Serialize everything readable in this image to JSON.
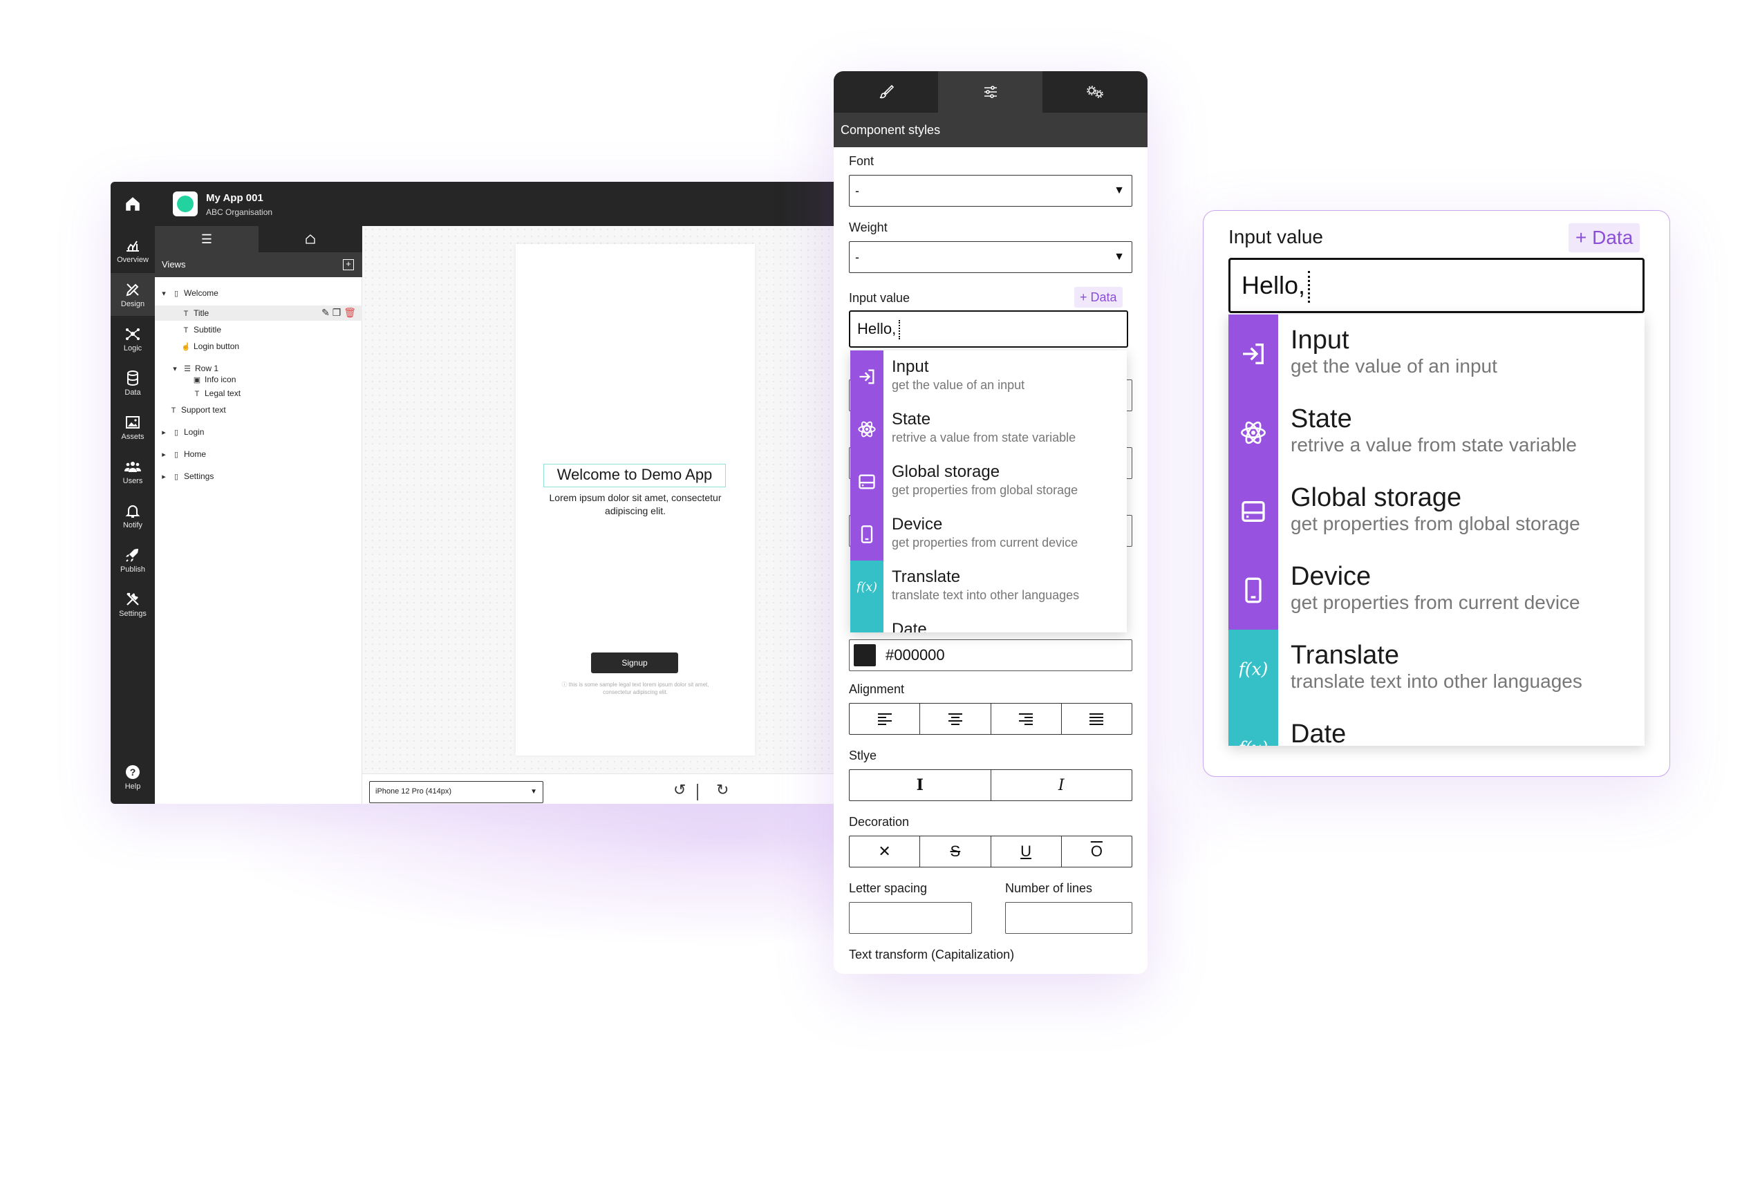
{
  "editor": {
    "app_name": "My App 001",
    "org_name": "ABC Organisation",
    "rail": [
      {
        "label": "Overview",
        "icon": "chart-icon"
      },
      {
        "label": "Design",
        "icon": "design-icon"
      },
      {
        "label": "Logic",
        "icon": "logic-icon"
      },
      {
        "label": "Data",
        "icon": "database-icon"
      },
      {
        "label": "Assets",
        "icon": "image-icon"
      },
      {
        "label": "Users",
        "icon": "users-icon"
      },
      {
        "label": "Notify",
        "icon": "bell-icon"
      },
      {
        "label": "Publish",
        "icon": "rocket-icon"
      },
      {
        "label": "Settings",
        "icon": "tools-icon"
      }
    ],
    "help_label": "Help",
    "views_label": "Views",
    "tree": [
      "Welcome",
      "Title",
      "Subtitle",
      "Login button",
      "Row 1",
      "Info icon",
      "Legal text",
      "Support text",
      "Login",
      "Home",
      "Settings"
    ],
    "phone": {
      "title": "Welcome to Demo App",
      "subtitle": "Lorem ipsum dolor sit amet, consectetur adipiscing elit.",
      "button": "Signup",
      "legal": "this is some sample legal text lorem ipsum dolor sit amet, consectetur adipiscing elit."
    },
    "device": "iPhone 12 Pro  (414px)"
  },
  "panel": {
    "header": "Component styles",
    "font_label": "Font",
    "font_value": "-",
    "weight_label": "Weight",
    "weight_value": "-",
    "input_label": "Input value",
    "data_button": "+ Data",
    "input_value": "Hello,",
    "color_value": "#000000",
    "alignment_label": "Alignment",
    "style_label": "Stlye",
    "decoration_label": "Decoration",
    "letter_spacing_label": "Letter spacing",
    "lines_label": "Number of lines",
    "transform_label": "Text transform (Capitalization)"
  },
  "dropdown": [
    {
      "title": "Input",
      "desc": "get the value of an input",
      "icon": "input-arrow-icon",
      "color": "#9852e0"
    },
    {
      "title": "State",
      "desc": "retrive a value from state variable",
      "icon": "atom-icon",
      "color": "#9852e0"
    },
    {
      "title": "Global storage",
      "desc": "get properties from global storage",
      "icon": "storage-icon",
      "color": "#9852e0"
    },
    {
      "title": "Device",
      "desc": "get properties from current device",
      "icon": "mobile-icon",
      "color": "#9852e0"
    },
    {
      "title": "Translate",
      "desc": "translate text into other languages",
      "icon": "function-icon",
      "color": "#35c0c8"
    },
    {
      "title": "Date",
      "desc": "",
      "icon": "function-icon",
      "color": "#35c0c8"
    }
  ],
  "zoom": {
    "label": "Input value",
    "data_button": "+ Data",
    "input_value": "Hello,"
  },
  "colors": {
    "dark": "#262626",
    "accent_purple": "#9852e0",
    "accent_teal": "#35c0c8"
  }
}
